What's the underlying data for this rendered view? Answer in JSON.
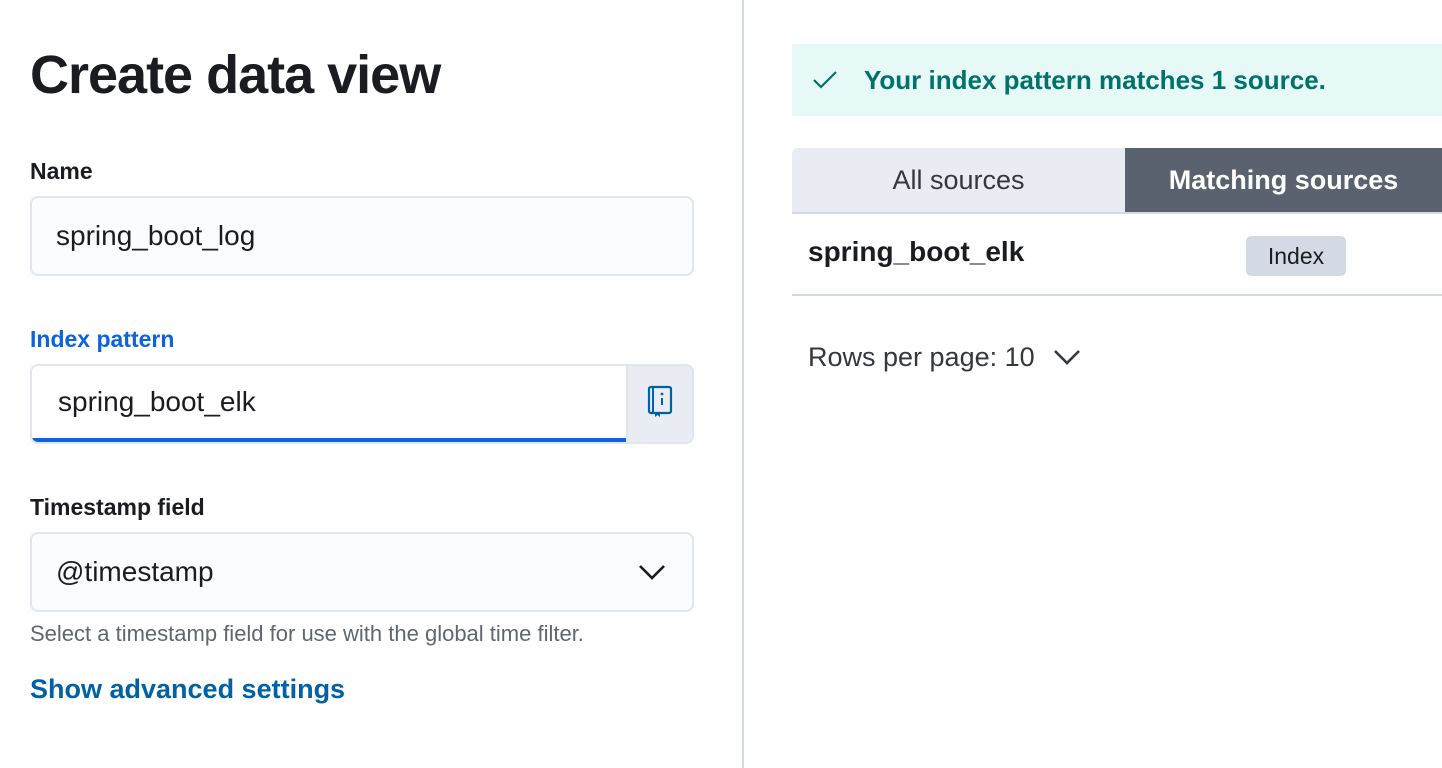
{
  "form": {
    "title": "Create data view",
    "name_label": "Name",
    "name_value": "spring_boot_log",
    "index_label": "Index pattern",
    "index_value": "spring_boot_elk",
    "timestamp_label": "Timestamp field",
    "timestamp_value": "@timestamp",
    "timestamp_help": "Select a timestamp field for use with the global time filter.",
    "advanced_link": "Show advanced settings"
  },
  "preview": {
    "callout_text": "Your index pattern matches 1 source.",
    "tabs": [
      {
        "label": "All sources",
        "selected": false
      },
      {
        "label": "Matching sources",
        "selected": true
      }
    ],
    "rows": [
      {
        "name": "spring_boot_elk",
        "type": "Index"
      }
    ],
    "rows_per_page": "Rows per page: 10"
  },
  "colors": {
    "accent": "#0b64dd",
    "success_bg": "#e6f9f7",
    "success_text": "#00726b",
    "selected_tab": "#5a6270"
  },
  "icons": {
    "index_help": "book-info-icon",
    "select_chevron": "chevron-down-icon",
    "callout_check": "check-icon",
    "pager_chevron": "chevron-down-icon"
  }
}
